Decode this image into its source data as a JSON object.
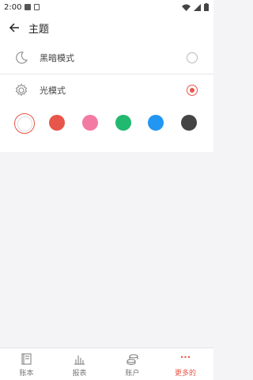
{
  "status": {
    "time": "2:00"
  },
  "header": {
    "title": "主题"
  },
  "theme_options": [
    {
      "label": "黑暗模式",
      "icon": "moon-icon",
      "selected": false
    },
    {
      "label": "光模式",
      "icon": "gear-icon",
      "selected": true
    }
  ],
  "colors": {
    "accent": "#e8554a",
    "swatches": [
      "#ffffff",
      "#e8554a",
      "#f27aa3",
      "#21b86f",
      "#2196f3",
      "#444444"
    ]
  },
  "nav": {
    "items": [
      {
        "label": "账本",
        "icon": "book-icon"
      },
      {
        "label": "报表",
        "icon": "chart-icon"
      },
      {
        "label": "账户",
        "icon": "coins-icon"
      },
      {
        "label": "更多的",
        "icon": "more-icon",
        "active": true
      }
    ]
  }
}
